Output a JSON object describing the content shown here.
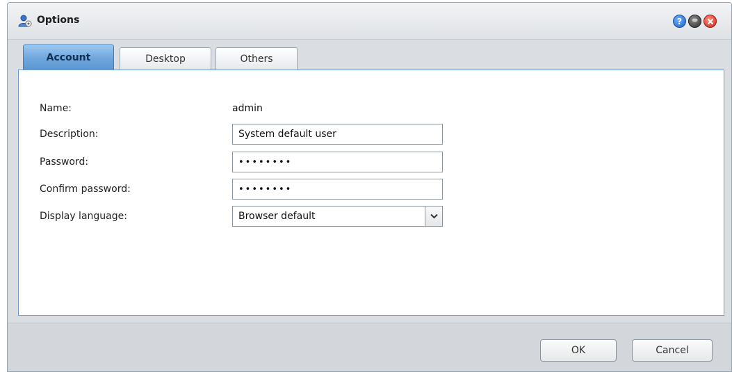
{
  "window": {
    "title": "Options"
  },
  "tabs": [
    {
      "label": "Account",
      "active": true
    },
    {
      "label": "Desktop",
      "active": false
    },
    {
      "label": "Others",
      "active": false
    }
  ],
  "form": {
    "name_label": "Name:",
    "name_value": "admin",
    "description_label": "Description:",
    "description_value": "System default user",
    "password_label": "Password:",
    "password_value": "••••••••",
    "confirm_label": "Confirm password:",
    "confirm_value": "••••••••",
    "language_label": "Display language:",
    "language_value": "Browser default"
  },
  "buttons": {
    "ok": "OK",
    "cancel": "Cancel"
  },
  "icons": {
    "app": "user-settings-icon",
    "help": "help-icon",
    "minimize": "minimize-icon",
    "close": "close-icon",
    "dropdown": "chevron-down-icon"
  },
  "colors": {
    "active_tab": "#6ea6dc",
    "panel_border": "#6d98c7",
    "close": "#c8271a",
    "help": "#1f62c6"
  }
}
